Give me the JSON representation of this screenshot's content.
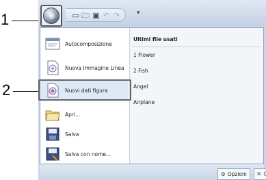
{
  "callouts": [
    "1",
    "2"
  ],
  "titlebar": {
    "right_glyph": "("
  },
  "quick_access": {
    "icons": [
      "new-icon",
      "open-icon",
      "save-icon",
      "undo-icon",
      "redo-icon"
    ],
    "dropdown_glyph": "▾"
  },
  "menu": {
    "items": [
      {
        "label": "Autocomposizione",
        "icon": "autocompose-icon"
      },
      {
        "label": "Nuova Immagine Linea",
        "icon": "new-line-image-icon"
      },
      {
        "label": "Nuovi dati figura",
        "icon": "new-figure-data-icon",
        "selected": true
      },
      {
        "label": "Apri...",
        "icon": "open-folder-icon"
      },
      {
        "label": "Salva",
        "icon": "save-icon"
      },
      {
        "label": "Salva con nome...",
        "icon": "save-as-icon"
      }
    ],
    "recent": {
      "title": "Ultimi file usati",
      "items": [
        "1 Flower",
        "2 Fish",
        "Angel",
        "Airplane"
      ]
    },
    "options_label": "Opzioni",
    "exit_glyph": "✕ C"
  }
}
